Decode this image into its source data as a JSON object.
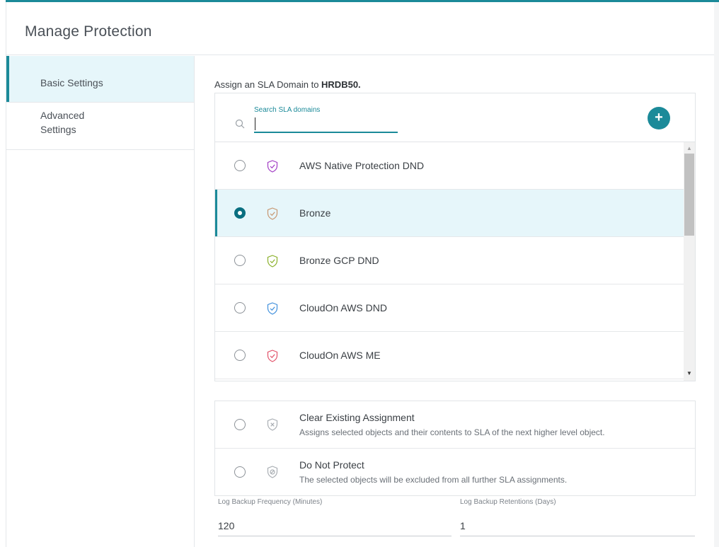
{
  "dialog": {
    "title": "Manage Protection"
  },
  "sidebar": {
    "items": [
      {
        "label": "Basic Settings"
      },
      {
        "label": "Advanced Settings"
      }
    ]
  },
  "assign": {
    "prefix": "Assign an SLA Domain to ",
    "object": "HRDB50."
  },
  "search": {
    "label": "Search SLA domains",
    "value": ""
  },
  "sla_domains": [
    {
      "name": "AWS Native Protection DND",
      "selected": false,
      "shield_color": "#a13cc4"
    },
    {
      "name": "Bronze",
      "selected": true,
      "shield_color": "#c79770"
    },
    {
      "name": "Bronze GCP DND",
      "selected": false,
      "shield_color": "#8ab02a"
    },
    {
      "name": "CloudOn AWS DND",
      "selected": false,
      "shield_color": "#3f8fdc"
    },
    {
      "name": "CloudOn AWS ME",
      "selected": false,
      "shield_color": "#e2526a"
    }
  ],
  "options": [
    {
      "title": "Clear Existing Assignment",
      "description": "Assigns selected objects and their contents to SLA of the next higher level object."
    },
    {
      "title": "Do Not Protect",
      "description": "The selected objects will be excluded from all further SLA assignments."
    }
  ],
  "fields": {
    "log_backup_frequency": {
      "label": "Log Backup Frequency (Minutes)",
      "value": "120"
    },
    "log_backup_retention": {
      "label": "Log Backup Retentions (Days)",
      "value": "1"
    }
  },
  "colors": {
    "accent": "#1b8a99",
    "selected_bg": "#e6f6fa"
  }
}
